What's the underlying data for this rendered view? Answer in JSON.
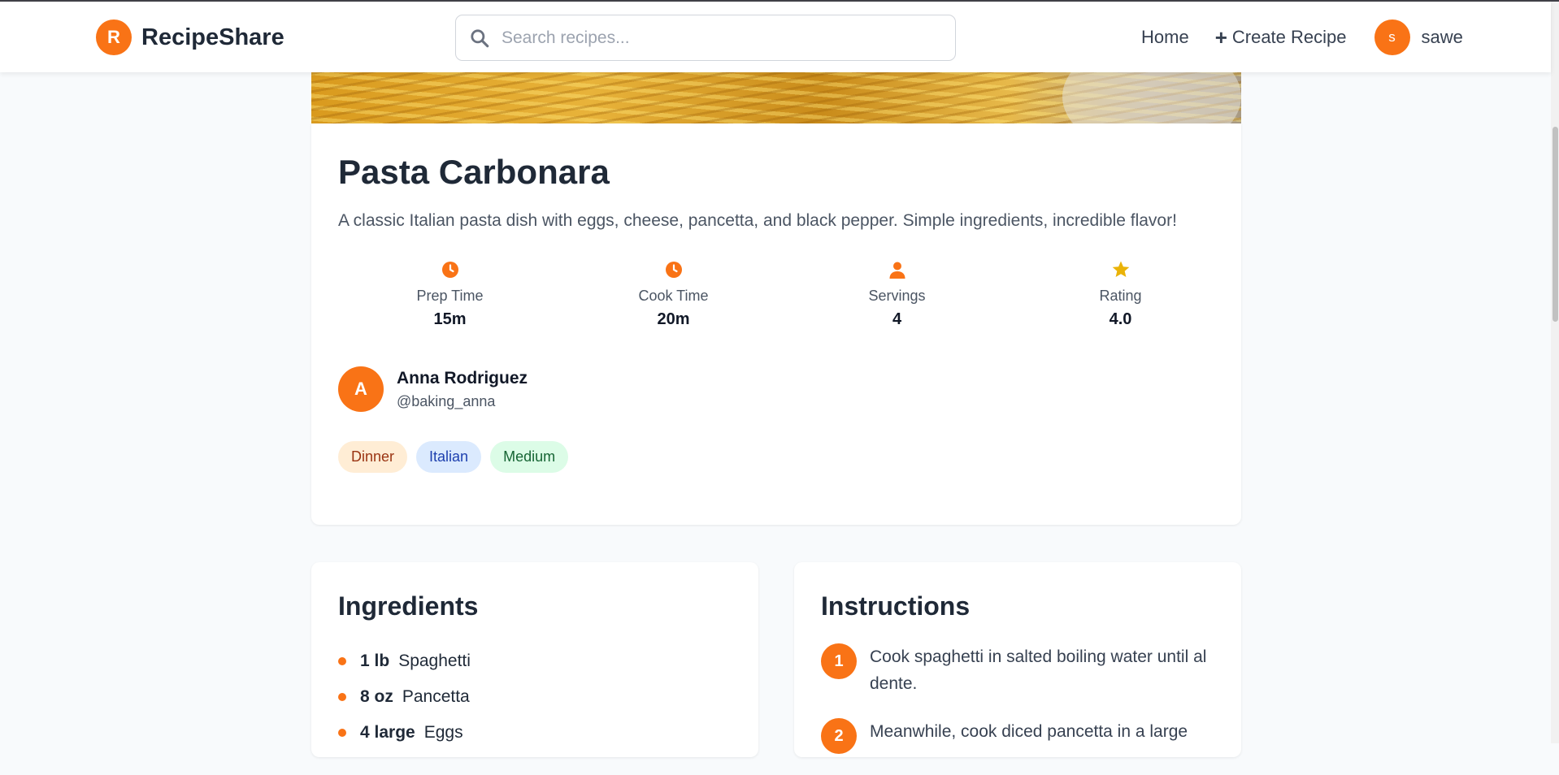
{
  "header": {
    "logo_letter": "R",
    "brand": "RecipeShare",
    "search_placeholder": "Search recipes...",
    "nav_home": "Home",
    "nav_create": "Create Recipe",
    "user_initial": "s",
    "username": "sawe"
  },
  "recipe": {
    "title": "Pasta Carbonara",
    "description": "A classic Italian pasta dish with eggs, cheese, pancetta, and black pepper. Simple ingredients, incredible flavor!",
    "stats": [
      {
        "icon": "clock-icon",
        "label": "Prep Time",
        "value": "15m"
      },
      {
        "icon": "clock-icon",
        "label": "Cook Time",
        "value": "20m"
      },
      {
        "icon": "user-icon",
        "label": "Servings",
        "value": "4"
      },
      {
        "icon": "star-icon",
        "label": "Rating",
        "value": "4.0"
      }
    ],
    "author": {
      "initial": "A",
      "name": "Anna Rodriguez",
      "handle": "@baking_anna"
    },
    "tags": [
      "Dinner",
      "Italian",
      "Medium"
    ]
  },
  "ingredients": {
    "title": "Ingredients",
    "items": [
      {
        "qty": "1 lb",
        "name": "Spaghetti"
      },
      {
        "qty": "8 oz",
        "name": "Pancetta"
      },
      {
        "qty": "4 large",
        "name": "Eggs"
      }
    ]
  },
  "instructions": {
    "title": "Instructions",
    "steps": [
      {
        "num": "1",
        "text": "Cook spaghetti in salted boiling water until al dente."
      },
      {
        "num": "2",
        "text": "Meanwhile, cook diced pancetta in a large"
      }
    ]
  },
  "colors": {
    "accent": "#f97316",
    "rating_star": "#eab308",
    "tag_dinner_bg": "#ffedd5",
    "tag_italian_bg": "#dbeafe",
    "tag_medium_bg": "#dcfce7"
  }
}
